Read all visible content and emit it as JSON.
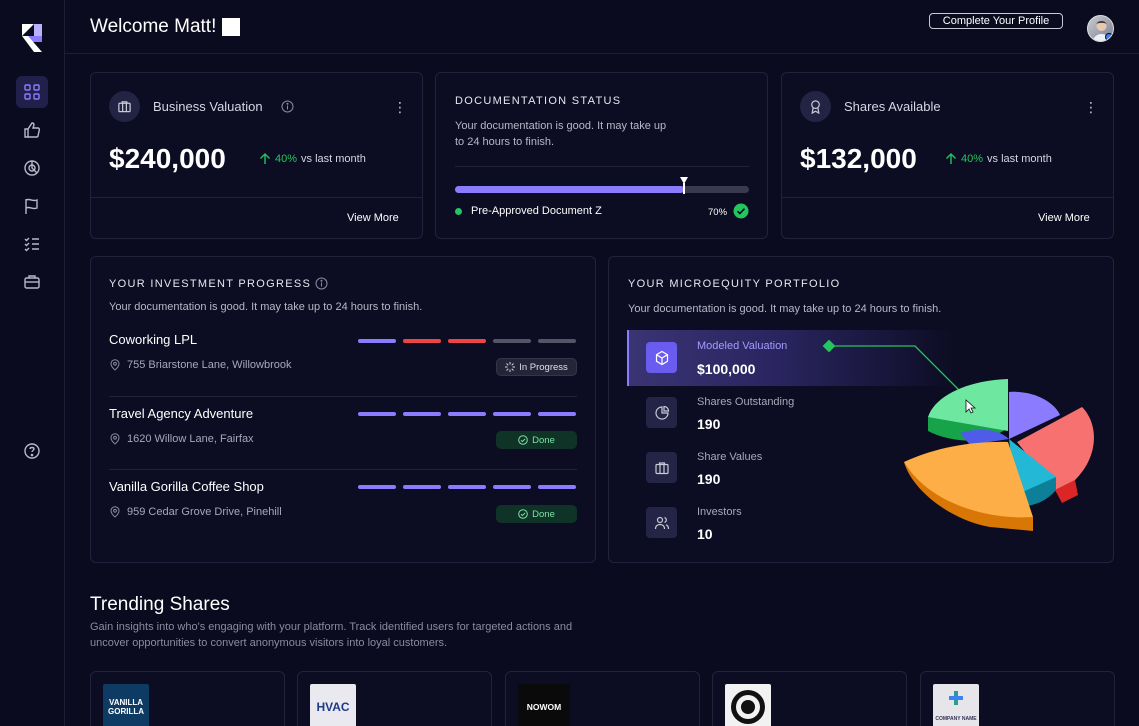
{
  "header": {
    "welcome": "Welcome Matt!",
    "profile_button": "Complete Your Profile"
  },
  "sidebar": {
    "items": [
      "dashboard-icon",
      "thumbs-up-icon",
      "chart-icon",
      "flag-icon",
      "checklist-icon",
      "briefcase-icon"
    ],
    "help": "help-icon"
  },
  "business_valuation": {
    "title": "Business Valuation",
    "value": "$240,000",
    "growth_pct": "40%",
    "growth_suffix": "vs last month",
    "view_more": "View More"
  },
  "documentation": {
    "title": "DOCUMENTATION STATUS",
    "text_line1": "Your documentation is good. It may take up",
    "text_line2": "to 24 hours to finish.",
    "progress": 0.78,
    "document": "Pre-Approved Document Z",
    "percent": "70%"
  },
  "shares_available": {
    "title": "Shares Available",
    "value": "$132,000",
    "growth_pct": "40%",
    "growth_suffix": "vs last month",
    "view_more": "View More"
  },
  "investment_progress": {
    "title": "YOUR INVESTMENT PROGRESS",
    "subtitle": "Your documentation is good. It may take up to 24 hours to finish.",
    "items": [
      {
        "name": "Coworking LPL",
        "address": "755 Briarstone Lane, Willowbrook",
        "status": "In Progress",
        "segments": [
          "#8b7bff",
          "#ef4444",
          "#ef4444",
          "#555566",
          "#555566"
        ]
      },
      {
        "name": "Travel Agency Adventure",
        "address": "1620 Willow Lane, Fairfax",
        "status": "Done",
        "segments": [
          "#8b7bff",
          "#8b7bff",
          "#8b7bff",
          "#8b7bff",
          "#8b7bff"
        ]
      },
      {
        "name": "Vanilla Gorilla Coffee Shop",
        "address": "959 Cedar Grove Drive, Pinehill",
        "status": "Done",
        "segments": [
          "#8b7bff",
          "#8b7bff",
          "#8b7bff",
          "#8b7bff",
          "#8b7bff"
        ]
      }
    ]
  },
  "portfolio": {
    "title": "YOUR MICROEQUITY PORTFOLIO",
    "subtitle": "Your documentation is good. It may take up to 24 hours to finish.",
    "metrics": [
      {
        "label": "Modeled Valuation",
        "value": "$100,000",
        "icon": "box-icon"
      },
      {
        "label": "Shares Outstanding",
        "value": "190",
        "icon": "pie-icon"
      },
      {
        "label": "Share Values",
        "value": "190",
        "icon": "briefcase-icon"
      },
      {
        "label": "Investors",
        "value": "10",
        "icon": "users-icon"
      }
    ]
  },
  "trending": {
    "title": "Trending Shares",
    "desc_line1": "Gain insights into who's engaging with your platform. Track identified users for targeted actions and",
    "desc_line2": "uncover opportunities to convert anonymous visitors into loyal customers.",
    "cards": [
      {
        "logo_text": "VANILLA GORILLA",
        "bg": "#0e3b64",
        "fg": "#ffffff"
      },
      {
        "logo_text": "HVAC",
        "bg": "#e9e9ef",
        "fg": "#1e3a8a"
      },
      {
        "logo_text": "NOWOM",
        "bg": "#0a0a0a",
        "fg": "#ffffff"
      },
      {
        "logo_text": "",
        "bg": "#f2f2f2",
        "fg": "#111111"
      },
      {
        "logo_text": "COMPANY NAME",
        "bg": "#e6e6ea",
        "fg": "#335"
      }
    ]
  }
}
